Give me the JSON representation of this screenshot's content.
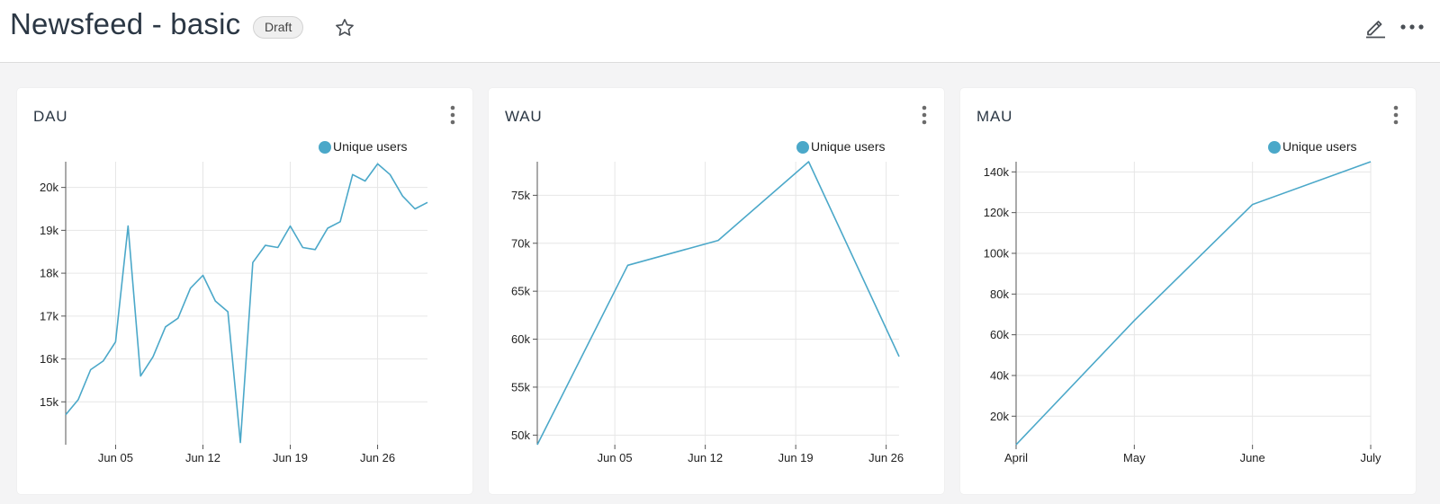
{
  "header": {
    "title": "Newsfeed - basic",
    "badge": "Draft",
    "icons": [
      "star-icon",
      "edit-icon",
      "more-horizontal-icon"
    ]
  },
  "colors": {
    "line": "#4ba8c9",
    "grid": "#e6e6e6",
    "axis": "#555555",
    "background": "#f4f4f5",
    "card": "#ffffff"
  },
  "cards": [
    {
      "title": "DAU",
      "legend": "Unique users"
    },
    {
      "title": "WAU",
      "legend": "Unique users"
    },
    {
      "title": "MAU",
      "legend": "Unique users"
    }
  ],
  "chart_data": [
    {
      "type": "line",
      "title": "DAU",
      "series": [
        {
          "name": "Unique users",
          "x": [
            "2023-06-01",
            "2023-06-02",
            "2023-06-03",
            "2023-06-04",
            "2023-06-05",
            "2023-06-06",
            "2023-06-07",
            "2023-06-08",
            "2023-06-09",
            "2023-06-10",
            "2023-06-11",
            "2023-06-12",
            "2023-06-13",
            "2023-06-14",
            "2023-06-15",
            "2023-06-16",
            "2023-06-17",
            "2023-06-18",
            "2023-06-19",
            "2023-06-20",
            "2023-06-21",
            "2023-06-22",
            "2023-06-23",
            "2023-06-24",
            "2023-06-25",
            "2023-06-26",
            "2023-06-27",
            "2023-06-28",
            "2023-06-29",
            "2023-06-30"
          ],
          "values": [
            14700,
            15050,
            15750,
            15950,
            16400,
            19100,
            15600,
            16050,
            16750,
            16950,
            17650,
            17950,
            17350,
            17100,
            14050,
            18250,
            18650,
            18600,
            19100,
            18600,
            18550,
            19050,
            19200,
            20300,
            20150,
            20550,
            20300,
            19800,
            19500,
            19650
          ]
        }
      ],
      "x_ticks": [
        "Jun 05",
        "Jun 12",
        "Jun 19",
        "Jun 26"
      ],
      "y_ticks": [
        "15k",
        "16k",
        "17k",
        "18k",
        "19k",
        "20k"
      ],
      "ylim": [
        14000,
        20600
      ],
      "grid": true,
      "legend_position": "top-right"
    },
    {
      "type": "line",
      "title": "WAU",
      "series": [
        {
          "name": "Unique users",
          "x": [
            "2023-05-30",
            "2023-06-06",
            "2023-06-13",
            "2023-06-20",
            "2023-06-27"
          ],
          "values": [
            49000,
            67700,
            70300,
            78500,
            58200
          ]
        }
      ],
      "x_ticks": [
        "Jun 05",
        "Jun 12",
        "Jun 19",
        "Jun 26"
      ],
      "y_ticks": [
        "50k",
        "55k",
        "60k",
        "65k",
        "70k",
        "75k"
      ],
      "ylim": [
        49000,
        78500
      ],
      "grid": true,
      "legend_position": "top-right"
    },
    {
      "type": "line",
      "title": "MAU",
      "series": [
        {
          "name": "Unique users",
          "x": [
            "April",
            "May",
            "June",
            "July"
          ],
          "values": [
            6000,
            67000,
            124000,
            145000
          ]
        }
      ],
      "x_ticks": [
        "April",
        "May",
        "June",
        "July"
      ],
      "y_ticks": [
        "20k",
        "40k",
        "60k",
        "80k",
        "100k",
        "120k",
        "140k"
      ],
      "ylim": [
        6000,
        145000
      ],
      "grid": true,
      "legend_position": "top-right"
    }
  ]
}
